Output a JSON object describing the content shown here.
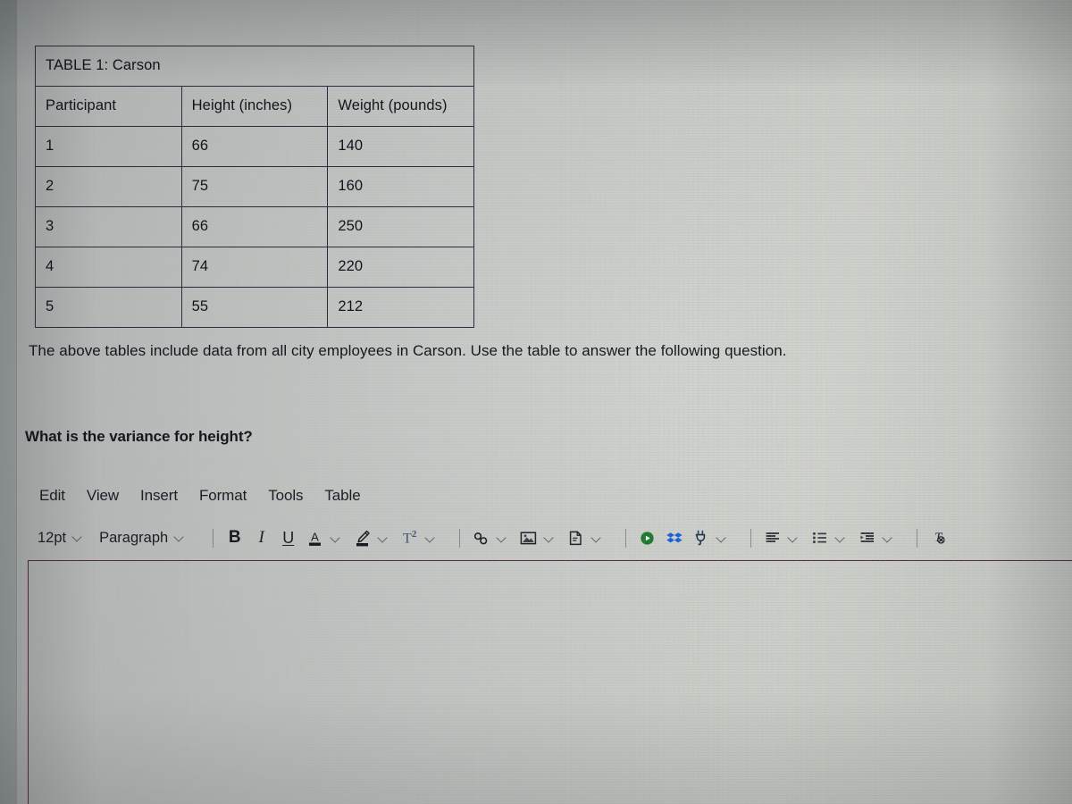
{
  "table": {
    "title": "TABLE 1: Carson",
    "columns": [
      "Participant",
      "Height (inches)",
      "Weight (pounds)"
    ],
    "rows": [
      {
        "participant": "1",
        "height": "66",
        "weight": "140"
      },
      {
        "participant": "2",
        "height": "75",
        "weight": "160"
      },
      {
        "participant": "3",
        "height": "66",
        "weight": "250"
      },
      {
        "participant": "4",
        "height": "74",
        "weight": "220"
      },
      {
        "participant": "5",
        "height": "55",
        "weight": "212"
      }
    ]
  },
  "prose": {
    "intro": "The above tables include data from all city employees in Carson. Use the table to answer the following question.",
    "question": "What is the variance for height?"
  },
  "editor": {
    "menubar": [
      {
        "label": "Edit"
      },
      {
        "label": "View"
      },
      {
        "label": "Insert"
      },
      {
        "label": "Format"
      },
      {
        "label": "Tools"
      },
      {
        "label": "Table"
      }
    ],
    "toolbar": {
      "font_size": "12pt",
      "block_format": "Paragraph",
      "bold_label": "B",
      "italic_label": "I",
      "underline_label": "U",
      "text_color_label": "A",
      "superscript_label": "T"
    },
    "colors": {
      "body_border": "#5d2342",
      "media_icon": "#1d7a2e",
      "dropbox_icon": "#1a5ed8",
      "accent_text": "#3c5570"
    },
    "content": ""
  }
}
